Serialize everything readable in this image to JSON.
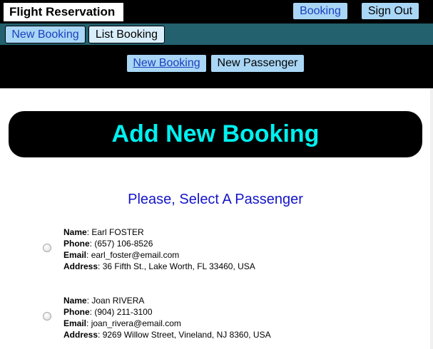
{
  "header": {
    "brand": "Flight Reservation",
    "booking_label": "Booking",
    "signout_label": "Sign Out"
  },
  "subnav": {
    "new_booking_label": "New Booking",
    "list_booking_label": "List Booking"
  },
  "tabs": {
    "new_booking_label": "New Booking",
    "new_passenger_label": "New Passenger"
  },
  "main": {
    "title": "Add New Booking",
    "subtitle": "Please, Select A Passenger"
  },
  "field_labels": {
    "name": "Name",
    "phone": "Phone",
    "email": "Email",
    "address": "Address"
  },
  "passengers": [
    {
      "name": "Earl FOSTER",
      "phone": "(657) 106-8526",
      "email": "earl_foster@email.com",
      "address": "36 Fifth St., Lake Worth, FL 33460, USA",
      "selected": false
    },
    {
      "name": "Joan RIVERA",
      "phone": "(904) 211-3100",
      "email": "joan_rivera@email.com",
      "address": "9269 Willow Street, Vineland, NJ 8360, USA",
      "selected": false
    }
  ],
  "colors": {
    "title_color": "#00f0f0",
    "subtitle_color": "#1414c8",
    "button_bg": "#a9d6f5",
    "link_color": "#1b3fbf",
    "subnav_bg": "#23616f"
  }
}
